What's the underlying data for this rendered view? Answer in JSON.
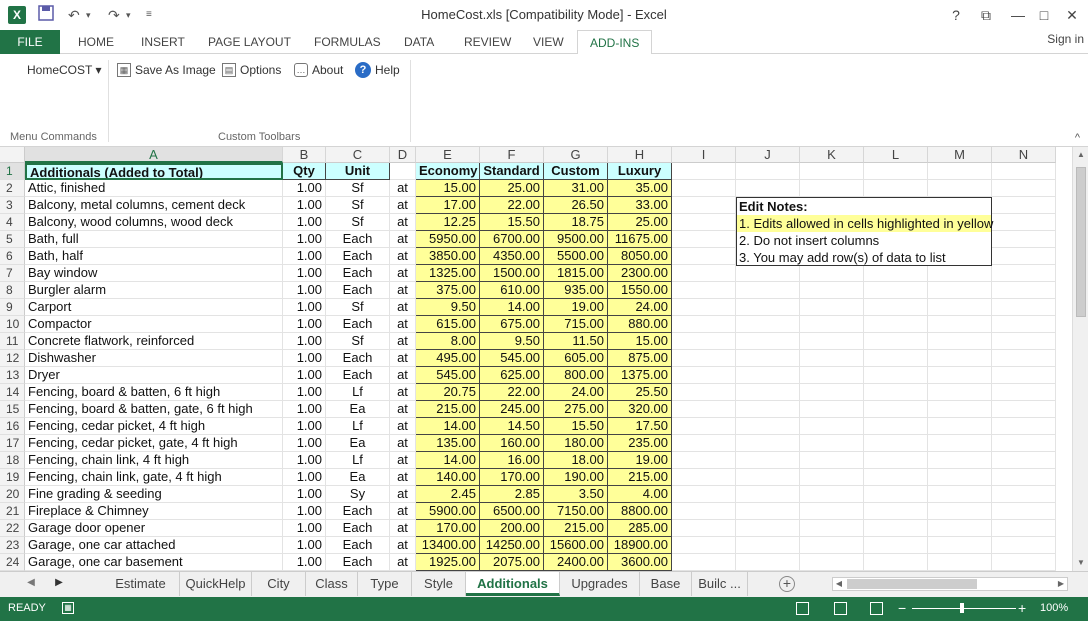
{
  "window": {
    "title": "HomeCost.xls  [Compatibility Mode] - Excel",
    "app_icon": "X",
    "qat": {
      "save_icon": "save-icon",
      "undo_icon": "undo-icon",
      "redo_icon": "redo-icon",
      "customize_icon": "customize-icon"
    },
    "help": "?",
    "restore_ribbon": "⧉",
    "minimize": "—",
    "maximize": "□",
    "close": "✕"
  },
  "ribbon_tabs": {
    "file": "FILE",
    "items": [
      "HOME",
      "INSERT",
      "PAGE LAYOUT",
      "FORMULAS",
      "DATA",
      "REVIEW",
      "VIEW",
      "ADD-INS"
    ],
    "active": "ADD-INS",
    "signin": "Sign in"
  },
  "ribbon": {
    "homecost_menu": "HomeCOST ▾",
    "save_image": "Save As Image",
    "options": "Options",
    "about": "About",
    "help": "Help",
    "group_menu": "Menu Commands",
    "group_toolbars": "Custom Toolbars",
    "collapse": "^"
  },
  "grid": {
    "columns": [
      "A",
      "B",
      "C",
      "D",
      "E",
      "F",
      "G",
      "H",
      "I",
      "J",
      "K",
      "L",
      "M",
      "N"
    ],
    "header_row": {
      "row": "1",
      "a": "Additionals (Added to Total)",
      "b": "Qty",
      "c": "Unit",
      "d": "",
      "e": "Economy",
      "f": "Standard",
      "g": "Custom",
      "h": "Luxury"
    },
    "rows": [
      {
        "row": "2",
        "a": "Attic, finished",
        "b": "1.00",
        "c": "Sf",
        "d": "at",
        "e": "15.00",
        "f": "25.00",
        "g": "31.00",
        "h": "35.00"
      },
      {
        "row": "3",
        "a": "Balcony, metal columns, cement deck",
        "b": "1.00",
        "c": "Sf",
        "d": "at",
        "e": "17.00",
        "f": "22.00",
        "g": "26.50",
        "h": "33.00"
      },
      {
        "row": "4",
        "a": "Balcony, wood columns, wood deck",
        "b": "1.00",
        "c": "Sf",
        "d": "at",
        "e": "12.25",
        "f": "15.50",
        "g": "18.75",
        "h": "25.00"
      },
      {
        "row": "5",
        "a": "Bath, full",
        "b": "1.00",
        "c": "Each",
        "d": "at",
        "e": "5950.00",
        "f": "6700.00",
        "g": "9500.00",
        "h": "11675.00"
      },
      {
        "row": "6",
        "a": "Bath, half",
        "b": "1.00",
        "c": "Each",
        "d": "at",
        "e": "3850.00",
        "f": "4350.00",
        "g": "5500.00",
        "h": "8050.00"
      },
      {
        "row": "7",
        "a": "Bay window",
        "b": "1.00",
        "c": "Each",
        "d": "at",
        "e": "1325.00",
        "f": "1500.00",
        "g": "1815.00",
        "h": "2300.00"
      },
      {
        "row": "8",
        "a": "Burgler alarm",
        "b": "1.00",
        "c": "Each",
        "d": "at",
        "e": "375.00",
        "f": "610.00",
        "g": "935.00",
        "h": "1550.00"
      },
      {
        "row": "9",
        "a": "Carport",
        "b": "1.00",
        "c": "Sf",
        "d": "at",
        "e": "9.50",
        "f": "14.00",
        "g": "19.00",
        "h": "24.00"
      },
      {
        "row": "10",
        "a": "Compactor",
        "b": "1.00",
        "c": "Each",
        "d": "at",
        "e": "615.00",
        "f": "675.00",
        "g": "715.00",
        "h": "880.00"
      },
      {
        "row": "11",
        "a": "Concrete flatwork, reinforced",
        "b": "1.00",
        "c": "Sf",
        "d": "at",
        "e": "8.00",
        "f": "9.50",
        "g": "11.50",
        "h": "15.00"
      },
      {
        "row": "12",
        "a": "Dishwasher",
        "b": "1.00",
        "c": "Each",
        "d": "at",
        "e": "495.00",
        "f": "545.00",
        "g": "605.00",
        "h": "875.00"
      },
      {
        "row": "13",
        "a": "Dryer",
        "b": "1.00",
        "c": "Each",
        "d": "at",
        "e": "545.00",
        "f": "625.00",
        "g": "800.00",
        "h": "1375.00"
      },
      {
        "row": "14",
        "a": "Fencing, board & batten, 6 ft high",
        "b": "1.00",
        "c": "Lf",
        "d": "at",
        "e": "20.75",
        "f": "22.00",
        "g": "24.00",
        "h": "25.50"
      },
      {
        "row": "15",
        "a": "Fencing, board & batten, gate, 6 ft high",
        "b": "1.00",
        "c": "Ea",
        "d": "at",
        "e": "215.00",
        "f": "245.00",
        "g": "275.00",
        "h": "320.00"
      },
      {
        "row": "16",
        "a": "Fencing, cedar picket, 4 ft high",
        "b": "1.00",
        "c": "Lf",
        "d": "at",
        "e": "14.00",
        "f": "14.50",
        "g": "15.50",
        "h": "17.50"
      },
      {
        "row": "17",
        "a": "Fencing, cedar picket, gate, 4 ft high",
        "b": "1.00",
        "c": "Ea",
        "d": "at",
        "e": "135.00",
        "f": "160.00",
        "g": "180.00",
        "h": "235.00"
      },
      {
        "row": "18",
        "a": "Fencing, chain link, 4 ft high",
        "b": "1.00",
        "c": "Lf",
        "d": "at",
        "e": "14.00",
        "f": "16.00",
        "g": "18.00",
        "h": "19.00"
      },
      {
        "row": "19",
        "a": "Fencing, chain link, gate, 4 ft high",
        "b": "1.00",
        "c": "Ea",
        "d": "at",
        "e": "140.00",
        "f": "170.00",
        "g": "190.00",
        "h": "215.00"
      },
      {
        "row": "20",
        "a": "Fine grading & seeding",
        "b": "1.00",
        "c": "Sy",
        "d": "at",
        "e": "2.45",
        "f": "2.85",
        "g": "3.50",
        "h": "4.00"
      },
      {
        "row": "21",
        "a": "Fireplace & Chimney",
        "b": "1.00",
        "c": "Each",
        "d": "at",
        "e": "5900.00",
        "f": "6500.00",
        "g": "7150.00",
        "h": "8800.00"
      },
      {
        "row": "22",
        "a": "Garage door opener",
        "b": "1.00",
        "c": "Each",
        "d": "at",
        "e": "170.00",
        "f": "200.00",
        "g": "215.00",
        "h": "285.00"
      },
      {
        "row": "23",
        "a": "Garage, one car attached",
        "b": "1.00",
        "c": "Each",
        "d": "at",
        "e": "13400.00",
        "f": "14250.00",
        "g": "15600.00",
        "h": "18900.00"
      },
      {
        "row": "24",
        "a": "Garage, one car basement",
        "b": "1.00",
        "c": "Each",
        "d": "at",
        "e": "1925.00",
        "f": "2075.00",
        "g": "2400.00",
        "h": "3600.00"
      }
    ]
  },
  "notes": {
    "title": "Edit Notes:",
    "lines": [
      "1. Edits allowed in cells highlighted in yellow",
      "2. Do not insert columns",
      "3. You may add row(s) of data to list"
    ]
  },
  "sheet_tabs": {
    "prev": "◀",
    "next": "▶",
    "items": [
      "Estimate",
      "QuickHelp",
      "City",
      "Class",
      "Type",
      "Style",
      "Additionals",
      "Upgrades",
      "Base",
      "Builc ..."
    ],
    "active": "Additionals",
    "add": "+"
  },
  "status": {
    "ready": "READY",
    "zoom": "100%",
    "zoom_minus": "−",
    "zoom_plus": "+"
  },
  "colors": {
    "excel_green": "#217346",
    "yellow_cell": "#ffff99",
    "header_cell": "#ccffff"
  }
}
